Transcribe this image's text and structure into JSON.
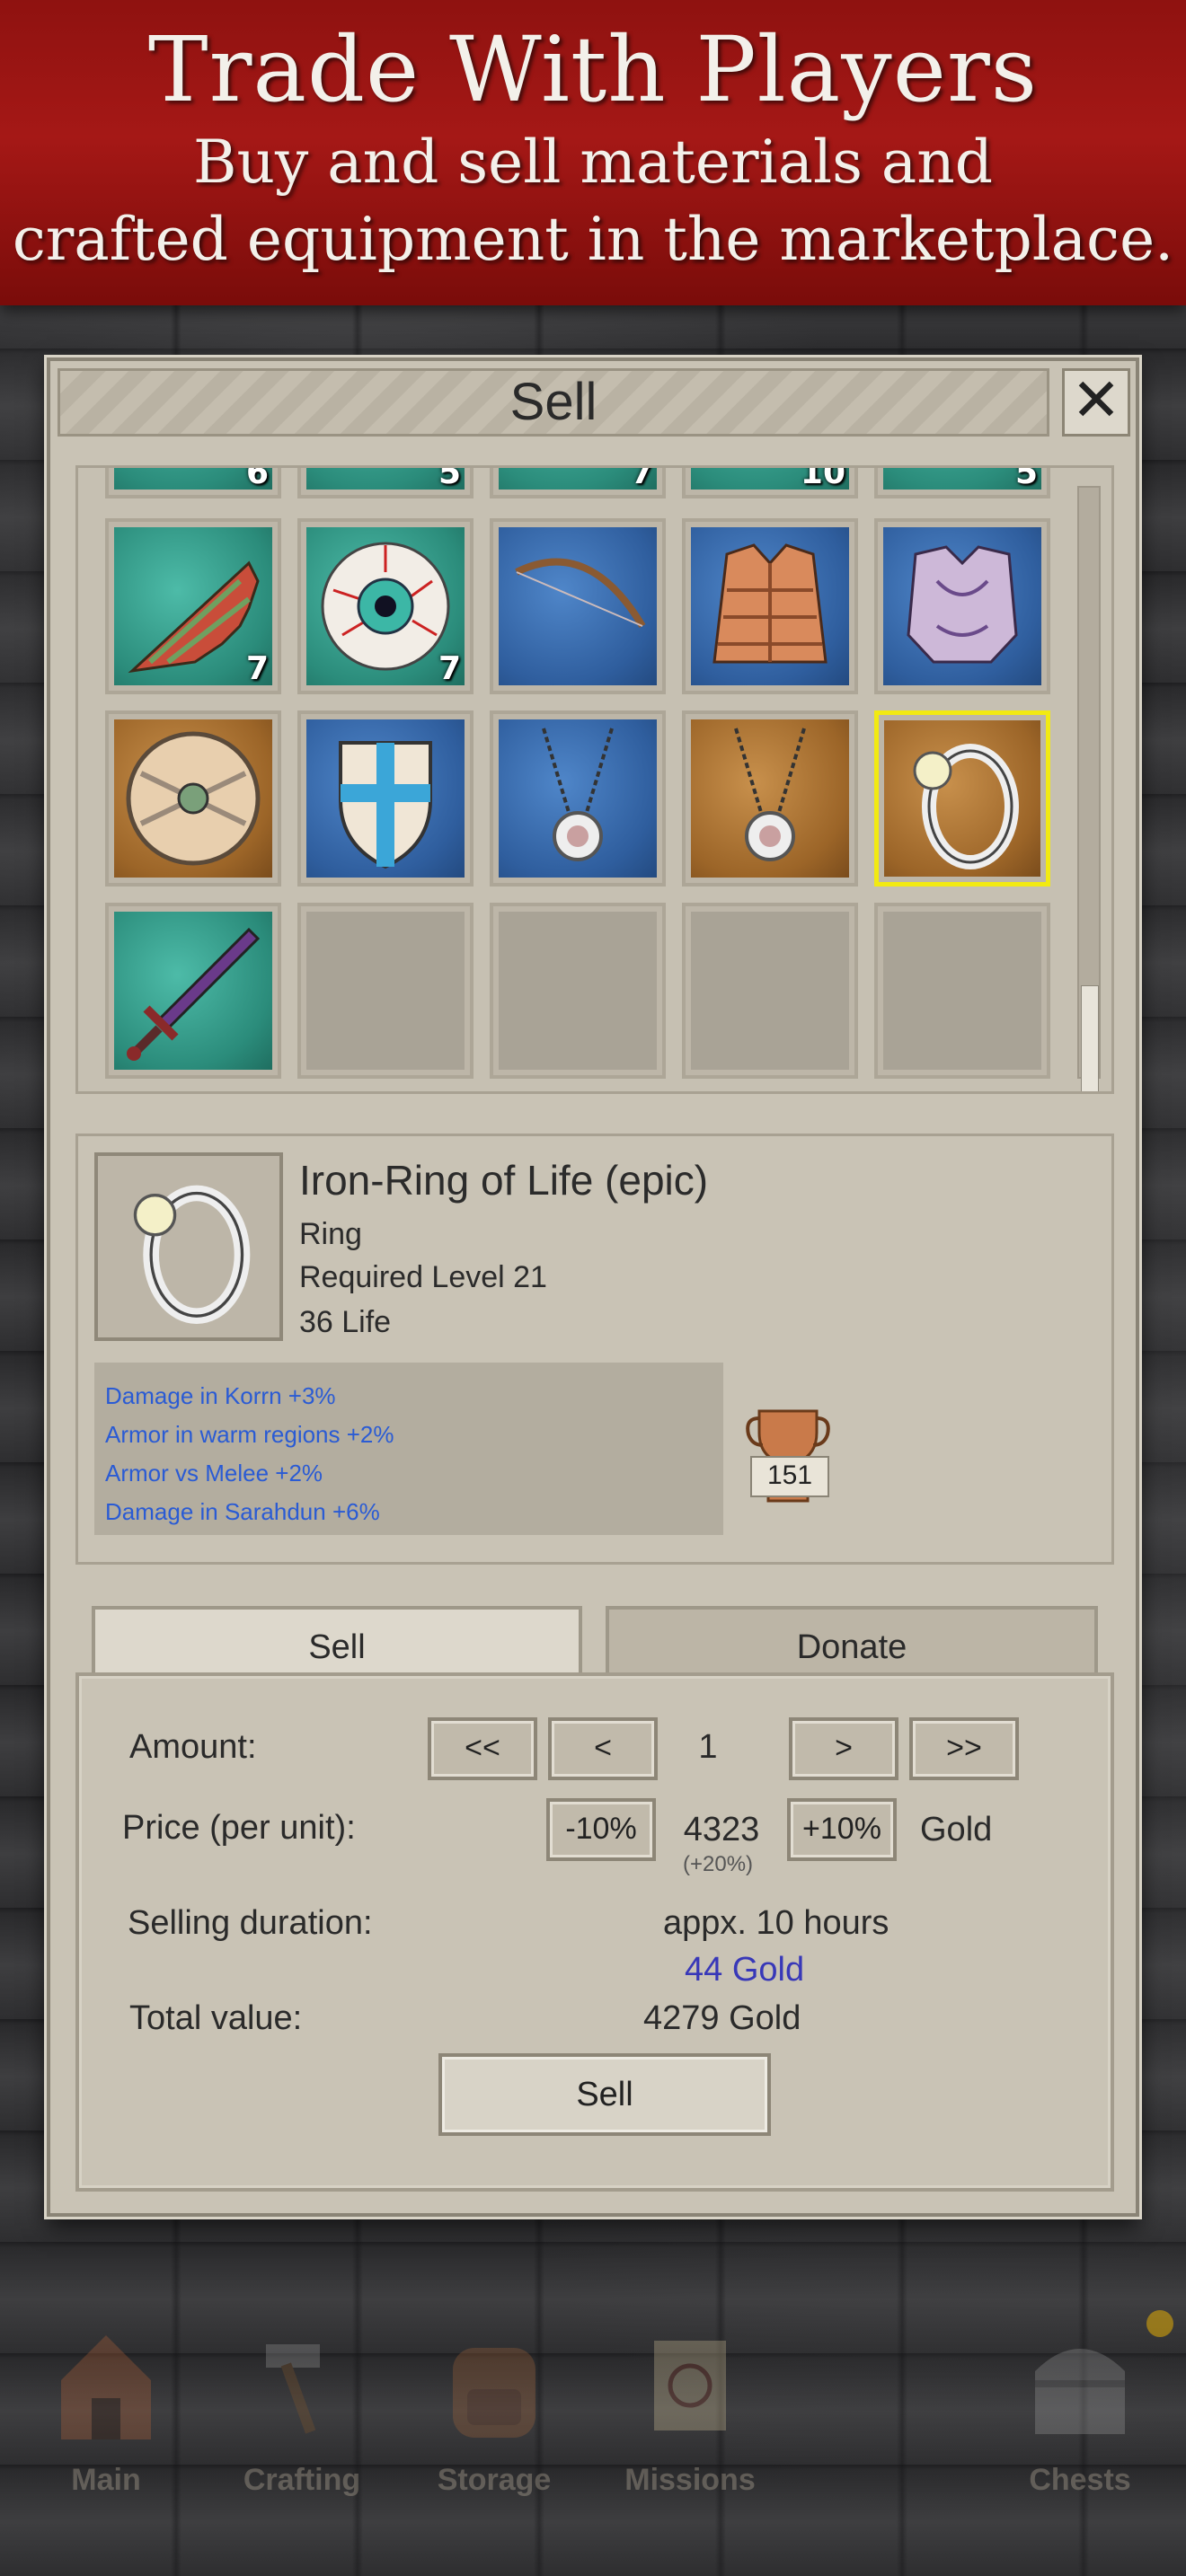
{
  "banner": {
    "title": "Trade With Players",
    "line1": "Buy and sell materials and",
    "line2": "crafted equipment in the marketplace."
  },
  "dialog": {
    "title": "Sell",
    "close_glyph": "✕"
  },
  "inventory": {
    "partial_row_quantities": [
      "6",
      "5",
      "7",
      "10",
      "5"
    ],
    "slots": [
      {
        "name": "lizard-scale",
        "qty": "7"
      },
      {
        "name": "eyeball",
        "qty": "7"
      },
      {
        "name": "wooden-bow",
        "qty": ""
      },
      {
        "name": "leather-armor",
        "qty": ""
      },
      {
        "name": "purple-chest-armor",
        "qty": ""
      },
      {
        "name": "round-wooden-shield",
        "qty": ""
      },
      {
        "name": "cross-shield",
        "qty": ""
      },
      {
        "name": "amulet-blue",
        "qty": ""
      },
      {
        "name": "amulet-brown",
        "qty": ""
      },
      {
        "name": "iron-ring",
        "qty": "",
        "selected": true
      },
      {
        "name": "sword",
        "qty": ""
      }
    ]
  },
  "item": {
    "name": "Iron-Ring of Life (epic)",
    "type": "Ring",
    "required_level": "Required Level 21",
    "stat": "36 Life",
    "bonuses": [
      "Damage in Korrn +3%",
      "Armor in warm regions +2%",
      "Armor vs Melee +2%",
      "Damage in Sarahdun +6%"
    ],
    "trophy_value": "151"
  },
  "tabs": {
    "sell": "Sell",
    "donate": "Donate"
  },
  "form": {
    "amount_label": "Amount:",
    "amount_first": "<<",
    "amount_prev": "<",
    "amount_value": "1",
    "amount_next": ">",
    "amount_last": ">>",
    "price_label": "Price (per unit):",
    "price_minus": "-10%",
    "price_value": "4323",
    "price_delta": "(+20%)",
    "price_plus": "+10%",
    "price_currency": "Gold",
    "duration_label": "Selling duration:",
    "duration_value": "appx. 10 hours",
    "fee": "44 Gold",
    "total_label": "Total value:",
    "total_value": "4279 Gold",
    "sell_button": "Sell"
  },
  "nav": [
    {
      "label": "Main",
      "icon": "house-icon"
    },
    {
      "label": "Crafting",
      "icon": "hammer-icon"
    },
    {
      "label": "Storage",
      "icon": "backpack-icon"
    },
    {
      "label": "Missions",
      "icon": "scroll-icon"
    },
    {
      "label": "",
      "icon": "trade-icon"
    },
    {
      "label": "Chests",
      "icon": "chest-icon"
    }
  ],
  "colors": {
    "banner": "#a51816",
    "selected_slot": "#f2ea12",
    "bonus_text": "#2a5bd4",
    "fee_text": "#3838b8"
  }
}
